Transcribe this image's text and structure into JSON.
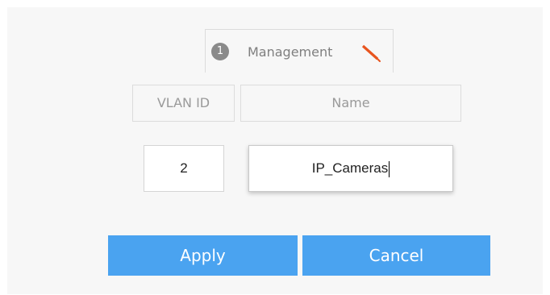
{
  "management": {
    "step_number": "1",
    "label": "Management",
    "icon": "pencil-icon",
    "icon_color": "#e8551f"
  },
  "table": {
    "headers": [
      "VLAN ID",
      "Name"
    ]
  },
  "row": {
    "vlan_id": "2",
    "name": "IP_Cameras"
  },
  "buttons": {
    "apply_label": "Apply",
    "cancel_label": "Cancel",
    "color": "#4aa3f0"
  }
}
